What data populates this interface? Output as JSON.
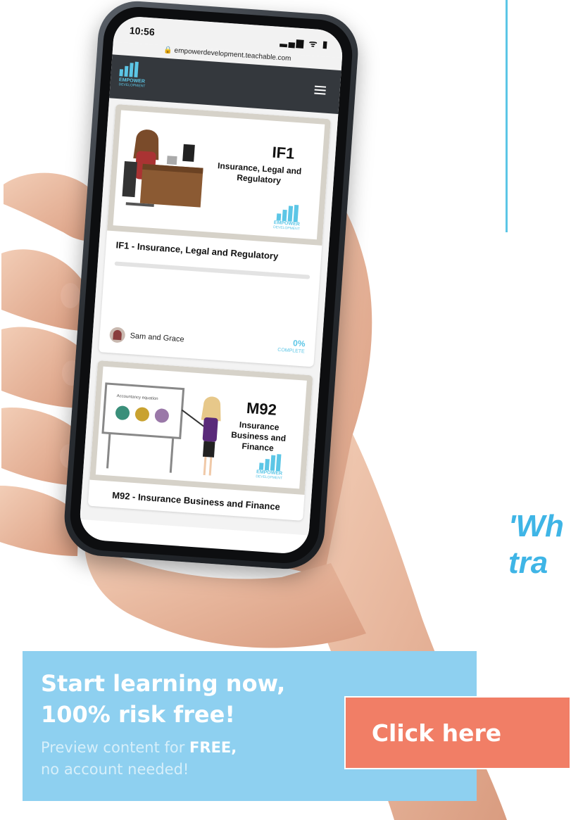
{
  "quote": {
    "line1": "'Wh",
    "line2": "tra"
  },
  "phone": {
    "status_time": "10:56",
    "status_icons": "▂▄▆ ᯤ ▮",
    "url": "🔒 empowerdevelopment.teachable.com",
    "logo_text": "EMPOWER",
    "logo_sub": "DEVELOPMENT"
  },
  "courses": [
    {
      "code": "IF1",
      "subtitle": "Insurance, Legal and Regulatory",
      "title": "IF1 - Insurance, Legal and Regulatory",
      "author": "Sam and Grace",
      "progress_percent": "0%",
      "progress_value": 0,
      "progress_label": "COMPLETE",
      "logo_text": "EMPOWER",
      "logo_sub": "DEVELOPMENT"
    },
    {
      "code": "M92",
      "subtitle": "Insurance Business and Finance",
      "title": "M92 - Insurance Business and Finance",
      "board_label": "Accountancy equation",
      "logo_text": "EMPOWER",
      "logo_sub": "DEVELOPMENT"
    }
  ],
  "banner": {
    "heading_line1": "Start learning now,",
    "heading_line2": "100% risk free!",
    "text_prefix": "Preview content for ",
    "text_bold": "FREE,",
    "text_line2": "no account needed!"
  },
  "cta": {
    "label": "Click here"
  },
  "colors": {
    "accent": "#5cc6e6",
    "banner": "#8ed0f0",
    "cta": "#f17e66",
    "navbar": "#34383d"
  }
}
